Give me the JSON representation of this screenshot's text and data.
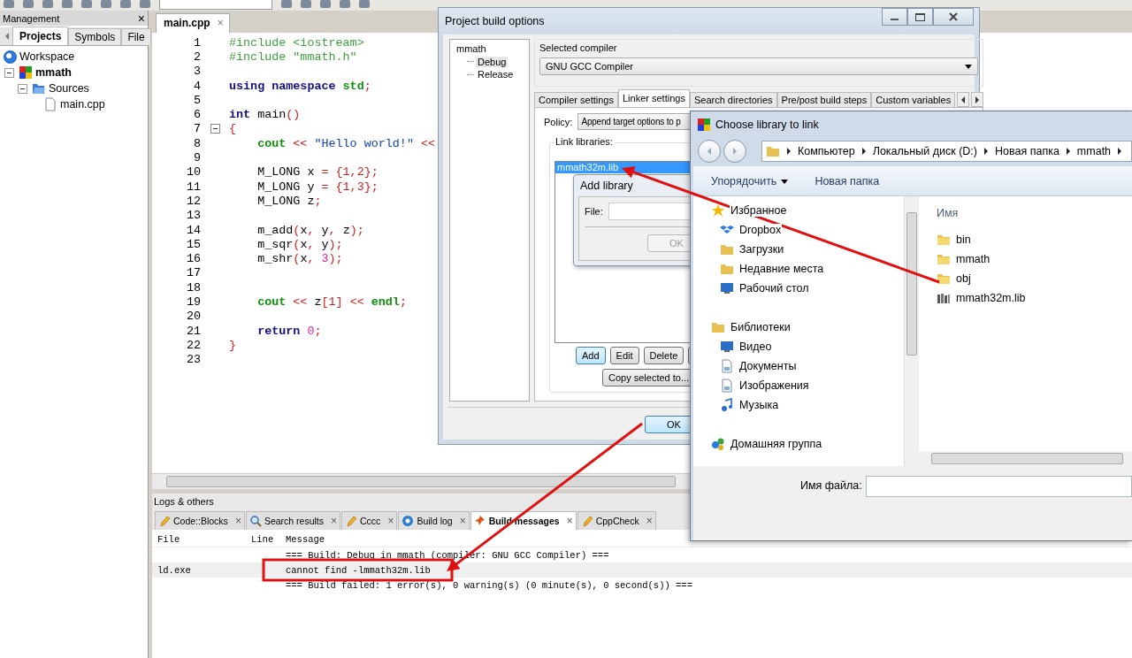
{
  "management": {
    "title": "Management",
    "close": "×",
    "tabs": [
      {
        "label": "Projects",
        "selected": true
      },
      {
        "label": "Symbols",
        "selected": false
      },
      {
        "label": "File",
        "selected": false
      }
    ],
    "tree": [
      {
        "label": "Workspace",
        "kind": "workspace",
        "children": [
          {
            "label": "mmath",
            "kind": "project",
            "expanded": true,
            "children": [
              {
                "label": "Sources",
                "kind": "folder",
                "expanded": true,
                "children": [
                  {
                    "label": "main.cpp",
                    "kind": "file"
                  }
                ]
              }
            ]
          }
        ]
      }
    ]
  },
  "editor": {
    "tab": {
      "label": "main.cpp",
      "close": "×"
    },
    "lines": [
      {
        "number": "1",
        "tokens": [
          {
            "text": "#include <iostream>",
            "kind": "pp"
          }
        ]
      },
      {
        "number": "2",
        "tokens": [
          {
            "text": "#include \"mmath.h\"",
            "kind": "pp"
          }
        ]
      },
      {
        "number": "3"
      },
      {
        "number": "4",
        "tokens": [
          {
            "text": "using namespace ",
            "kind": "kw"
          },
          {
            "text": "std",
            "kind": "lib"
          },
          {
            "text": ";",
            "kind": "op"
          }
        ]
      },
      {
        "number": "5"
      },
      {
        "number": "6",
        "tokens": [
          {
            "text": "int ",
            "kind": "kw"
          },
          {
            "text": "main",
            "kind": "plain"
          },
          {
            "text": "()",
            "kind": "op"
          }
        ]
      },
      {
        "number": "7",
        "fold": true,
        "tokens": [
          {
            "text": "{",
            "kind": "op"
          }
        ]
      },
      {
        "number": "8",
        "tokens": [
          {
            "text": "    cout ",
            "kind": "lib"
          },
          {
            "text": "<< ",
            "kind": "op"
          },
          {
            "text": "\"Hello world!\" ",
            "kind": "str"
          },
          {
            "text": "<<",
            "kind": "op"
          }
        ]
      },
      {
        "number": "9"
      },
      {
        "number": "10",
        "tokens": [
          {
            "text": "    M_LONG x ",
            "kind": "plain"
          },
          {
            "text": "= {1,2};",
            "kind": "op"
          }
        ]
      },
      {
        "number": "11",
        "tokens": [
          {
            "text": "    M_LONG y ",
            "kind": "plain"
          },
          {
            "text": "= {1,3};",
            "kind": "op"
          }
        ]
      },
      {
        "number": "12",
        "tokens": [
          {
            "text": "    M_LONG z",
            "kind": "plain"
          },
          {
            "text": ";",
            "kind": "op"
          }
        ]
      },
      {
        "number": "13"
      },
      {
        "number": "14",
        "tokens": [
          {
            "text": "    m_add",
            "kind": "plain"
          },
          {
            "text": "(",
            "kind": "op"
          },
          {
            "text": "x",
            "kind": "plain"
          },
          {
            "text": ", ",
            "kind": "op"
          },
          {
            "text": "y",
            "kind": "plain"
          },
          {
            "text": ", ",
            "kind": "op"
          },
          {
            "text": "z",
            "kind": "plain"
          },
          {
            "text": ");",
            "kind": "op"
          }
        ]
      },
      {
        "number": "15",
        "tokens": [
          {
            "text": "    m_sqr",
            "kind": "plain"
          },
          {
            "text": "(",
            "kind": "op"
          },
          {
            "text": "x",
            "kind": "plain"
          },
          {
            "text": ", ",
            "kind": "op"
          },
          {
            "text": "y",
            "kind": "plain"
          },
          {
            "text": ");",
            "kind": "op"
          }
        ]
      },
      {
        "number": "16",
        "tokens": [
          {
            "text": "    m_shr",
            "kind": "plain"
          },
          {
            "text": "(",
            "kind": "op"
          },
          {
            "text": "x",
            "kind": "plain"
          },
          {
            "text": ", ",
            "kind": "op"
          },
          {
            "text": "3",
            "kind": "num"
          },
          {
            "text": ");",
            "kind": "op"
          }
        ]
      },
      {
        "number": "17"
      },
      {
        "number": "18"
      },
      {
        "number": "19",
        "tokens": [
          {
            "text": "    cout ",
            "kind": "lib"
          },
          {
            "text": "<< ",
            "kind": "op"
          },
          {
            "text": "z",
            "kind": "plain"
          },
          {
            "text": "[1] << ",
            "kind": "op"
          },
          {
            "text": "endl",
            "kind": "lib"
          },
          {
            "text": ";",
            "kind": "op"
          }
        ]
      },
      {
        "number": "20"
      },
      {
        "number": "21",
        "tokens": [
          {
            "text": "    return ",
            "kind": "kw"
          },
          {
            "text": "0",
            "kind": "num"
          },
          {
            "text": ";",
            "kind": "op"
          }
        ]
      },
      {
        "number": "22",
        "tokens": [
          {
            "text": "}",
            "kind": "op"
          }
        ]
      },
      {
        "number": "23"
      }
    ]
  },
  "logs": {
    "title": "Logs & others",
    "tabs": [
      {
        "label": "Code::Blocks",
        "close": "×",
        "selected": false
      },
      {
        "label": "Search results",
        "close": "×",
        "selected": false
      },
      {
        "label": "Cccc",
        "close": "×",
        "selected": false
      },
      {
        "label": "Build log",
        "close": "×",
        "selected": false
      },
      {
        "label": "Build messages",
        "close": "×",
        "selected": true
      },
      {
        "label": "CppCheck",
        "close": "×",
        "selected": false
      }
    ],
    "columns": [
      "File",
      "Line",
      "Message"
    ],
    "rows": [
      {
        "message": "=== Build: Debug in mmath (compiler: GNU GCC Compiler) ===",
        "selected": false
      },
      {
        "file": "ld.exe",
        "message": "cannot find -lmmath32m.lib",
        "selected": true
      },
      {
        "message": "=== Build failed: 1 error(s), 0 warning(s) (0 minute(s), 0 second(s)) ===",
        "selected": false
      }
    ]
  },
  "build_options": {
    "title": "Project build options",
    "targets": [
      {
        "label": "mmath",
        "selected": false,
        "children": [
          {
            "label": "Debug",
            "selected": true
          },
          {
            "label": "Release",
            "selected": false
          }
        ]
      }
    ],
    "compiler_label": "Selected compiler",
    "compiler": "GNU GCC Compiler",
    "tabs": [
      {
        "label": "Compiler settings",
        "selected": false
      },
      {
        "label": "Linker settings",
        "selected": true
      },
      {
        "label": "Search directories",
        "selected": false
      },
      {
        "label": "Pre/post build steps",
        "selected": false
      },
      {
        "label": "Custom variables",
        "selected": false
      }
    ],
    "policy_label": "Policy:",
    "policy": "Append target options to p",
    "libraries_label": "Link libraries:",
    "libraries": [
      {
        "label": "mmath32m.lib",
        "selected": true
      }
    ],
    "buttons": [
      {
        "label": "Add",
        "focused": true
      },
      {
        "label": "Edit",
        "focused": false
      },
      {
        "label": "Delete",
        "focused": false
      }
    ],
    "copy_button": "Copy selected to...",
    "ok": "OK"
  },
  "add_library": {
    "title": "Add library",
    "file_label": "File:",
    "ok": {
      "label": "OK",
      "disabled": true
    }
  },
  "file_dialog": {
    "title": "Choose library to link",
    "path": [
      "Компьютер",
      "Локальный диск (D:)",
      "Новая папка",
      "mmath"
    ],
    "organize": "Упорядочить",
    "new_folder": "Новая папка",
    "nav": [
      {
        "label": "Избранное",
        "children": [
          {
            "label": "Dropbox"
          },
          {
            "label": "Загрузки"
          },
          {
            "label": "Недавние места"
          },
          {
            "label": "Рабочий стол"
          }
        ]
      },
      {
        "label": "Библиотеки",
        "children": [
          {
            "label": "Видео"
          },
          {
            "label": "Документы"
          },
          {
            "label": "Изображения"
          },
          {
            "label": "Музыка"
          }
        ]
      },
      {
        "label": "Домашняя группа"
      }
    ],
    "column": "Имя",
    "files": [
      {
        "label": "bin",
        "kind": "folder"
      },
      {
        "label": "mmath",
        "kind": "folder"
      },
      {
        "label": "obj",
        "kind": "folder"
      },
      {
        "label": "mmath32m.lib",
        "kind": "library"
      }
    ],
    "filename_label": "Имя файла:"
  }
}
